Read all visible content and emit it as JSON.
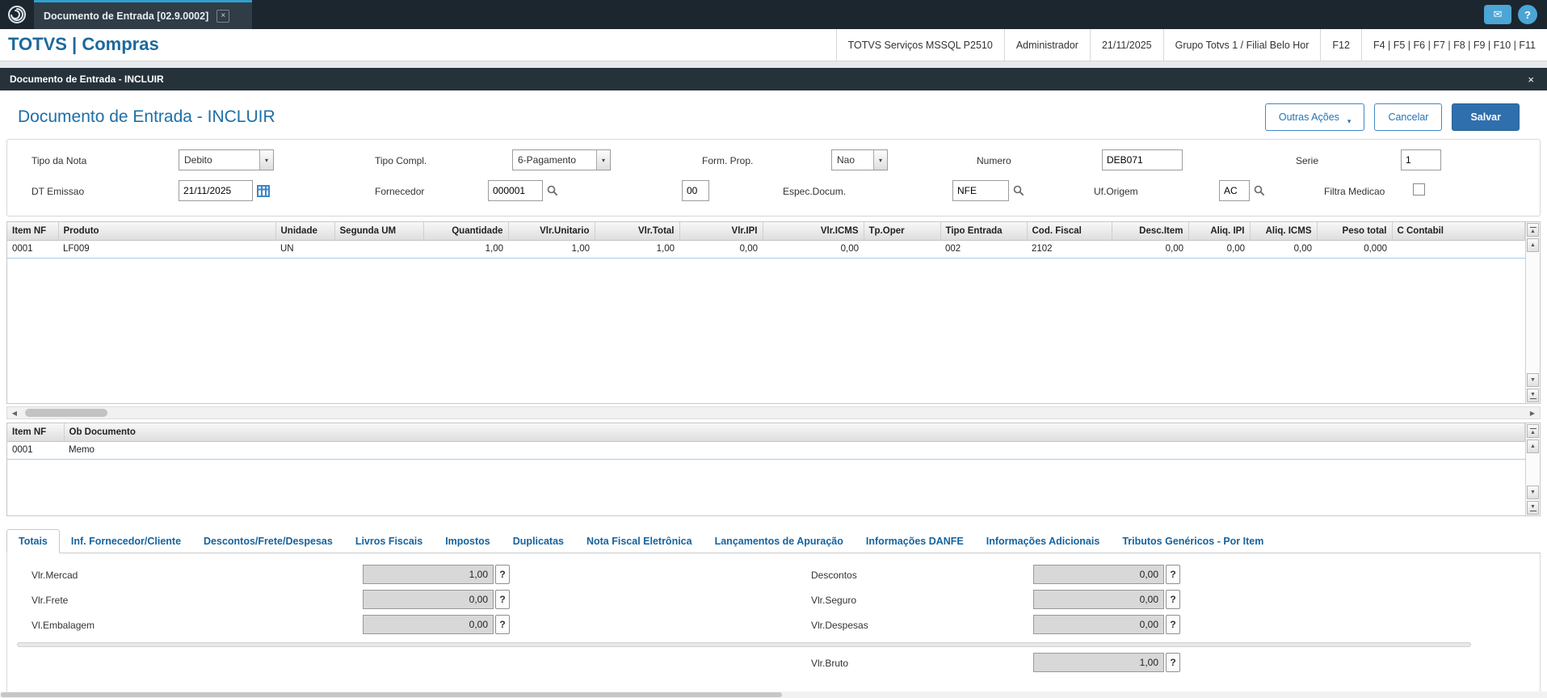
{
  "glyphs": {
    "close": "×",
    "dropdown": "▾",
    "up": "▲",
    "down": "▼",
    "left": "◀",
    "right": "▶",
    "mail": "✉",
    "help": "?",
    "question": "?"
  },
  "colors": {
    "accent": "#2574b5",
    "topbar": "#1c262e",
    "tab_accent": "#2f9fd0",
    "salvar_bg": "#2f6fad",
    "readonly_bg": "#d8d8d8"
  },
  "topbar": {
    "tab_title": "Documento de Entrada [02.9.0002]"
  },
  "appbar": {
    "brand": "TOTVS | Compras",
    "environment": "TOTVS Serviços MSSQL P2510",
    "user": "Administrador",
    "date": "21/11/2025",
    "branch": "Grupo Totvs 1 / Filial Belo Hor",
    "f12": "F12",
    "fkeys": "F4 | F5 | F6 | F7 | F8 | F9 | F10 | F11"
  },
  "window": {
    "title": "Documento de Entrada - INCLUIR"
  },
  "page": {
    "title": "Documento de Entrada - INCLUIR",
    "outras_acoes": "Outras Ações",
    "cancelar": "Cancelar",
    "salvar": "Salvar"
  },
  "form": {
    "tipo_nota_label": "Tipo da Nota",
    "tipo_nota_value": "Debito",
    "tipo_compl_label": "Tipo Compl.",
    "tipo_compl_value": "6-Pagamento",
    "form_prop_label": "Form. Prop.",
    "form_prop_value": "Nao",
    "numero_label": "Numero",
    "numero_value": "DEB071",
    "serie_label": "Serie",
    "serie_value": "1",
    "dt_emissao_label": "DT Emissao",
    "dt_emissao_value": "21/11/2025",
    "fornecedor_label": "Fornecedor",
    "fornecedor_value": "000001",
    "loja_value": "00",
    "espec_label": "Espec.Docum.",
    "espec_value": "NFE",
    "uf_label": "Uf.Origem",
    "uf_value": "AC",
    "filtra_label": "Filtra Medicao"
  },
  "items_grid": {
    "columns": [
      "Item NF",
      "Produto",
      "Unidade",
      "Segunda UM",
      "Quantidade",
      "Vlr.Unitario",
      "Vlr.Total",
      "Vlr.IPI",
      "Vlr.ICMS",
      "Tp.Oper",
      "Tipo Entrada",
      "Cod. Fiscal",
      "Desc.Item",
      "Aliq. IPI",
      "Aliq. ICMS",
      "Peso total",
      "C Contabil"
    ],
    "rows": [
      [
        "0001",
        "LF009",
        "UN",
        "",
        "1,00",
        "1,00",
        "1,00",
        "0,00",
        "0,00",
        "",
        "002",
        "2102",
        "0,00",
        "0,00",
        "0,00",
        "0,000",
        ""
      ]
    ]
  },
  "obs_grid": {
    "columns": [
      "Item NF",
      "Ob Documento"
    ],
    "rows": [
      [
        "0001",
        "Memo"
      ]
    ]
  },
  "tabs": [
    "Totais",
    "Inf. Fornecedor/Cliente",
    "Descontos/Frete/Despesas",
    "Livros Fiscais",
    "Impostos",
    "Duplicatas",
    "Nota Fiscal Eletrônica",
    "Lançamentos de Apuração",
    "Informações DANFE",
    "Informações Adicionais",
    "Tributos Genéricos - Por Item"
  ],
  "totals": {
    "vlr_mercad_label": "Vlr.Mercad",
    "vlr_mercad": "1,00",
    "vlr_frete_label": "Vlr.Frete",
    "vlr_frete": "0,00",
    "vl_embalagem_label": "Vl.Embalagem",
    "vl_embalagem": "0,00",
    "descontos_label": "Descontos",
    "descontos": "0,00",
    "vlr_seguro_label": "Vlr.Seguro",
    "vlr_seguro": "0,00",
    "vlr_despesas_label": "Vlr.Despesas",
    "vlr_despesas": "0,00",
    "vlr_bruto_label": "Vlr.Bruto",
    "vlr_bruto": "1,00"
  }
}
